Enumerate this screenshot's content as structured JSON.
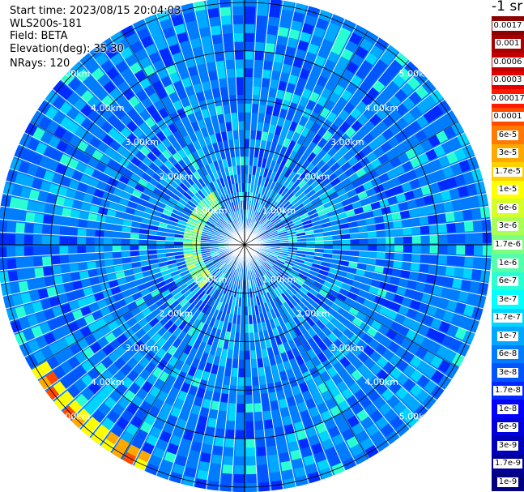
{
  "info": {
    "start_time": "Start time: 2023/08/15 20:04:03",
    "instrument": "WLS200s-181",
    "field": "Field: BETA",
    "elevation": "Elevation(deg): 35.30",
    "nrays": "NRays: 120"
  },
  "colorbar": {
    "unit_title": "-1 sr",
    "entries": [
      {
        "label": "0.0017",
        "color": "#8b0000"
      },
      {
        "label": "0.001",
        "color": "#a80000"
      },
      {
        "label": "0.0006",
        "color": "#c40000"
      },
      {
        "label": "0.0003",
        "color": "#e00000"
      },
      {
        "label": "0.00017",
        "color": "#ff1a00"
      },
      {
        "label": "0.0001",
        "color": "#ff4a00"
      },
      {
        "label": "6e-5",
        "color": "#ff7a00"
      },
      {
        "label": "3e-5",
        "color": "#ffa800"
      },
      {
        "label": "1.7e-5",
        "color": "#ffd000"
      },
      {
        "label": "1e-5",
        "color": "#ffff00"
      },
      {
        "label": "6e-6",
        "color": "#d4ff2a"
      },
      {
        "label": "3e-6",
        "color": "#a8ff55"
      },
      {
        "label": "1.7e-6",
        "color": "#7dff80"
      },
      {
        "label": "1e-6",
        "color": "#55ffaa"
      },
      {
        "label": "6e-7",
        "color": "#2affd4"
      },
      {
        "label": "3e-7",
        "color": "#00ffff"
      },
      {
        "label": "1.7e-7",
        "color": "#00d4ff"
      },
      {
        "label": "1e-7",
        "color": "#00a8ff"
      },
      {
        "label": "6e-8",
        "color": "#007dff"
      },
      {
        "label": "3e-8",
        "color": "#0055ff"
      },
      {
        "label": "1.7e-8",
        "color": "#002aff"
      },
      {
        "label": "1e-8",
        "color": "#0000ff"
      },
      {
        "label": "6e-9",
        "color": "#0000dd"
      },
      {
        "label": "3e-9",
        "color": "#0000bb"
      },
      {
        "label": "1.7e-9",
        "color": "#000099"
      },
      {
        "label": "1e-9",
        "color": "#000080"
      }
    ]
  },
  "chart_data": {
    "type": "heatmap",
    "projection": "polar (PPI)",
    "rays": 120,
    "range_ring_labels": [
      "1.00km",
      "2.00km",
      "3.00km",
      "4.00km",
      "5.00km"
    ],
    "range_rings_km": [
      1,
      2,
      3,
      4,
      5
    ],
    "max_range_km": 5.1,
    "radial_lines_deg": [
      0,
      30,
      60,
      90,
      120,
      150,
      180,
      210,
      240,
      270,
      300,
      330
    ],
    "dominant_value": "3e-8",
    "notable_features": [
      {
        "description": "green/yellow arc",
        "range_km": [
          0.9,
          1.3
        ],
        "azimuth_deg": [
          225,
          330
        ],
        "value": "1e-6"
      },
      {
        "description": "yellow/red band",
        "range_km": [
          4.8,
          5.1
        ],
        "azimuth_deg": [
          205,
          240
        ],
        "value": "1e-5"
      }
    ]
  }
}
